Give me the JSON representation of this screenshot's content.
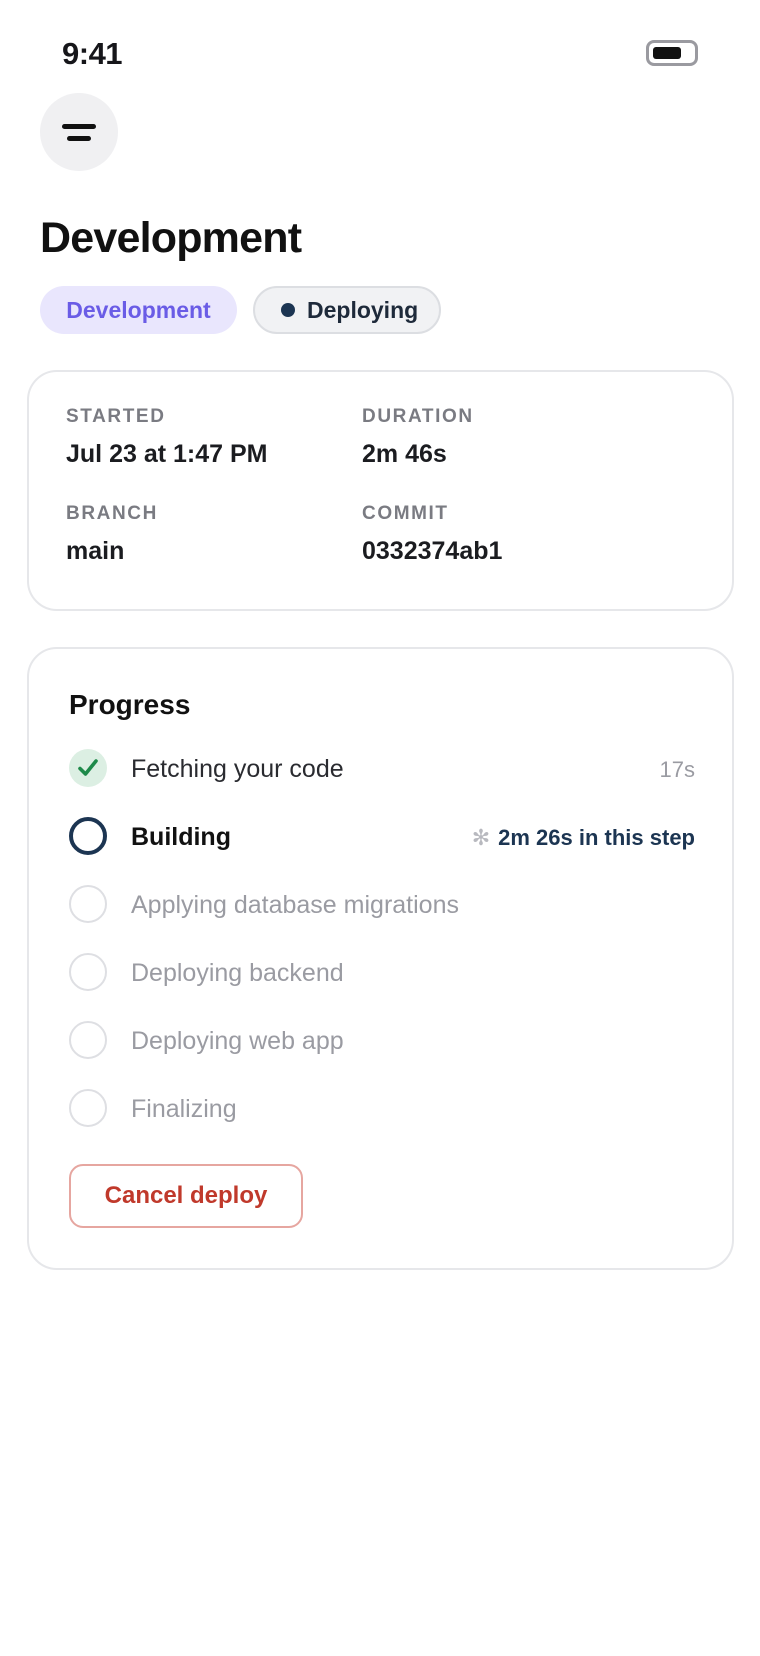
{
  "status_bar": {
    "time": "9:41"
  },
  "header": {
    "title": "Development"
  },
  "badges": {
    "environment": "Development",
    "status": "Deploying"
  },
  "info": [
    {
      "label": "STARTED",
      "value": "Jul 23 at 1:47 PM"
    },
    {
      "label": "DURATION",
      "value": "2m 46s"
    },
    {
      "label": "BRANCH",
      "value": "main"
    },
    {
      "label": "COMMIT",
      "value": "0332374ab1"
    }
  ],
  "progress": {
    "title": "Progress",
    "steps": [
      {
        "label": "Fetching your code",
        "state": "done",
        "meta": "17s"
      },
      {
        "label": "Building",
        "state": "active",
        "meta": "2m 26s in this step"
      },
      {
        "label": "Applying database migrations",
        "state": "pending"
      },
      {
        "label": "Deploying backend",
        "state": "pending"
      },
      {
        "label": "Deploying web app",
        "state": "pending"
      },
      {
        "label": "Finalizing",
        "state": "pending"
      }
    ],
    "cancel_label": "Cancel deploy"
  },
  "colors": {
    "accent": "#6a5ce6",
    "accent_bg": "#e9e6fd",
    "active_step": "#1c3552",
    "success": "#1e8a4a",
    "danger": "#c0392b"
  },
  "icons": {
    "menu": "menu-icon",
    "battery": "battery-icon",
    "done_step": "checkmark-icon",
    "active_meta": "spinner-icon"
  }
}
